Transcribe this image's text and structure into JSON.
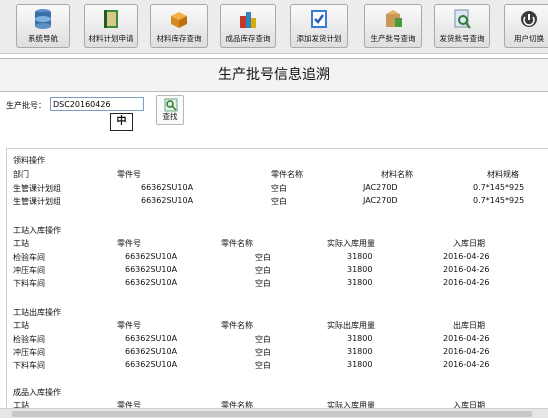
{
  "toolbar": {
    "buttons": [
      {
        "label": "系统导航",
        "icon": "database-icon"
      },
      {
        "label": "材料计划申请",
        "icon": "book-icon"
      },
      {
        "label": "材料库存查询",
        "icon": "box-icon"
      },
      {
        "label": "成品库存查询",
        "icon": "products-icon"
      },
      {
        "label": "添加发货计划",
        "icon": "checklist-icon"
      },
      {
        "label": "生产批号查询",
        "icon": "package-icon"
      },
      {
        "label": "发货批号查询",
        "icon": "search-doc-icon"
      },
      {
        "label": "用户切换",
        "icon": "user-switch-icon"
      }
    ]
  },
  "page_title": "生产批号信息追溯",
  "search": {
    "label": "生产批号：",
    "value": "DSC20160426",
    "ime_indicator": "中",
    "find_label": "查找"
  },
  "sections": {
    "material_ops": {
      "title": "领料操作",
      "headers": [
        "部门",
        "零件号",
        "零件名称",
        "材料名称",
        "材料规格"
      ],
      "rows": [
        [
          "生管课计划组",
          "66362SU10A",
          "空白",
          "JAC270D",
          "0.7*145*925"
        ],
        [
          "生管课计划组",
          "66362SU10A",
          "空白",
          "JAC270D",
          "0.7*145*925"
        ]
      ]
    },
    "station_in": {
      "title": "工站入库操作",
      "headers": [
        "工站",
        "零件号",
        "零件名称",
        "实际入库用量",
        "入库日期"
      ],
      "rows": [
        [
          "检验车间",
          "66362SU10A",
          "空白",
          "31800",
          "2016-04-26"
        ],
        [
          "冲压车间",
          "66362SU10A",
          "空白",
          "31800",
          "2016-04-26"
        ],
        [
          "下料车间",
          "66362SU10A",
          "空白",
          "31800",
          "2016-04-26"
        ]
      ]
    },
    "station_out": {
      "title": "工站出库操作",
      "headers": [
        "工站",
        "零件号",
        "零件名称",
        "实际出库用量",
        "出库日期"
      ],
      "rows": [
        [
          "检验车间",
          "66362SU10A",
          "空白",
          "31800",
          "2016-04-26"
        ],
        [
          "冲压车间",
          "66362SU10A",
          "空白",
          "31800",
          "2016-04-26"
        ],
        [
          "下料车间",
          "66362SU10A",
          "空白",
          "31800",
          "2016-04-26"
        ]
      ]
    },
    "product_in": {
      "title": "成品入库操作",
      "headers": [
        "工站",
        "零件号",
        "零件名称",
        "实际入库用量",
        "入库日期"
      ]
    }
  },
  "colors": {
    "toolbar_bg": "#ececec",
    "input_border": "#7a9cc5",
    "title_bg": "#f3f3f3"
  }
}
